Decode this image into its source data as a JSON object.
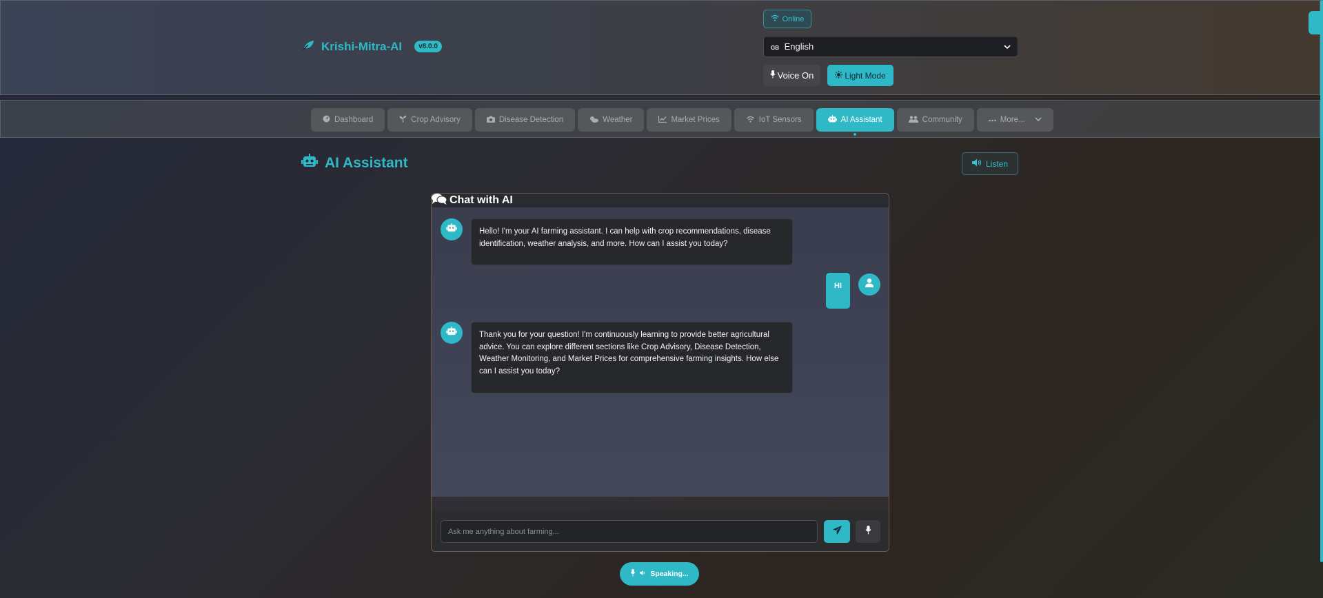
{
  "header": {
    "brand_name": "Krishi-Mitra-AI",
    "version": "v8.0.0",
    "status": "Online",
    "language": {
      "flag": "GB",
      "selected": "English"
    },
    "voice_button": "Voice On",
    "theme_button": "Light Mode"
  },
  "nav": {
    "tabs": [
      {
        "label": "Dashboard",
        "icon": "gauge-icon"
      },
      {
        "label": "Crop Advisory",
        "icon": "seedling-icon"
      },
      {
        "label": "Disease Detection",
        "icon": "camera-icon"
      },
      {
        "label": "Weather",
        "icon": "cloud-sun-icon"
      },
      {
        "label": "Market Prices",
        "icon": "chart-line-icon"
      },
      {
        "label": "IoT Sensors",
        "icon": "wifi-icon"
      },
      {
        "label": "AI Assistant",
        "icon": "robot-icon",
        "active": true
      },
      {
        "label": "Community",
        "icon": "users-icon"
      },
      {
        "label": "More...",
        "icon": "ellipsis-icon"
      }
    ]
  },
  "page": {
    "title": "AI Assistant",
    "listen_button": "Listen"
  },
  "chat": {
    "title": "Chat with AI",
    "messages": [
      {
        "role": "bot",
        "text": "Hello! I'm your AI farming assistant. I can help with crop recommendations, disease identification, weather analysis, and more. How can I assist you today?"
      },
      {
        "role": "user",
        "text": "HI"
      },
      {
        "role": "bot",
        "text": "Thank you for your question! I'm continuously learning to provide better agricultural advice. You can explore different sections like Crop Advisory, Disease Detection, Weather Monitoring, and Market Prices for comprehensive farming insights. How else can I assist you today?"
      }
    ],
    "input_placeholder": "Ask me anything about farming...",
    "input_value": ""
  },
  "speaking_status": "Speaking...",
  "colors": {
    "accent": "#2fb8c6",
    "bubble_bot": "#27282c",
    "background": "#2b2a30"
  }
}
